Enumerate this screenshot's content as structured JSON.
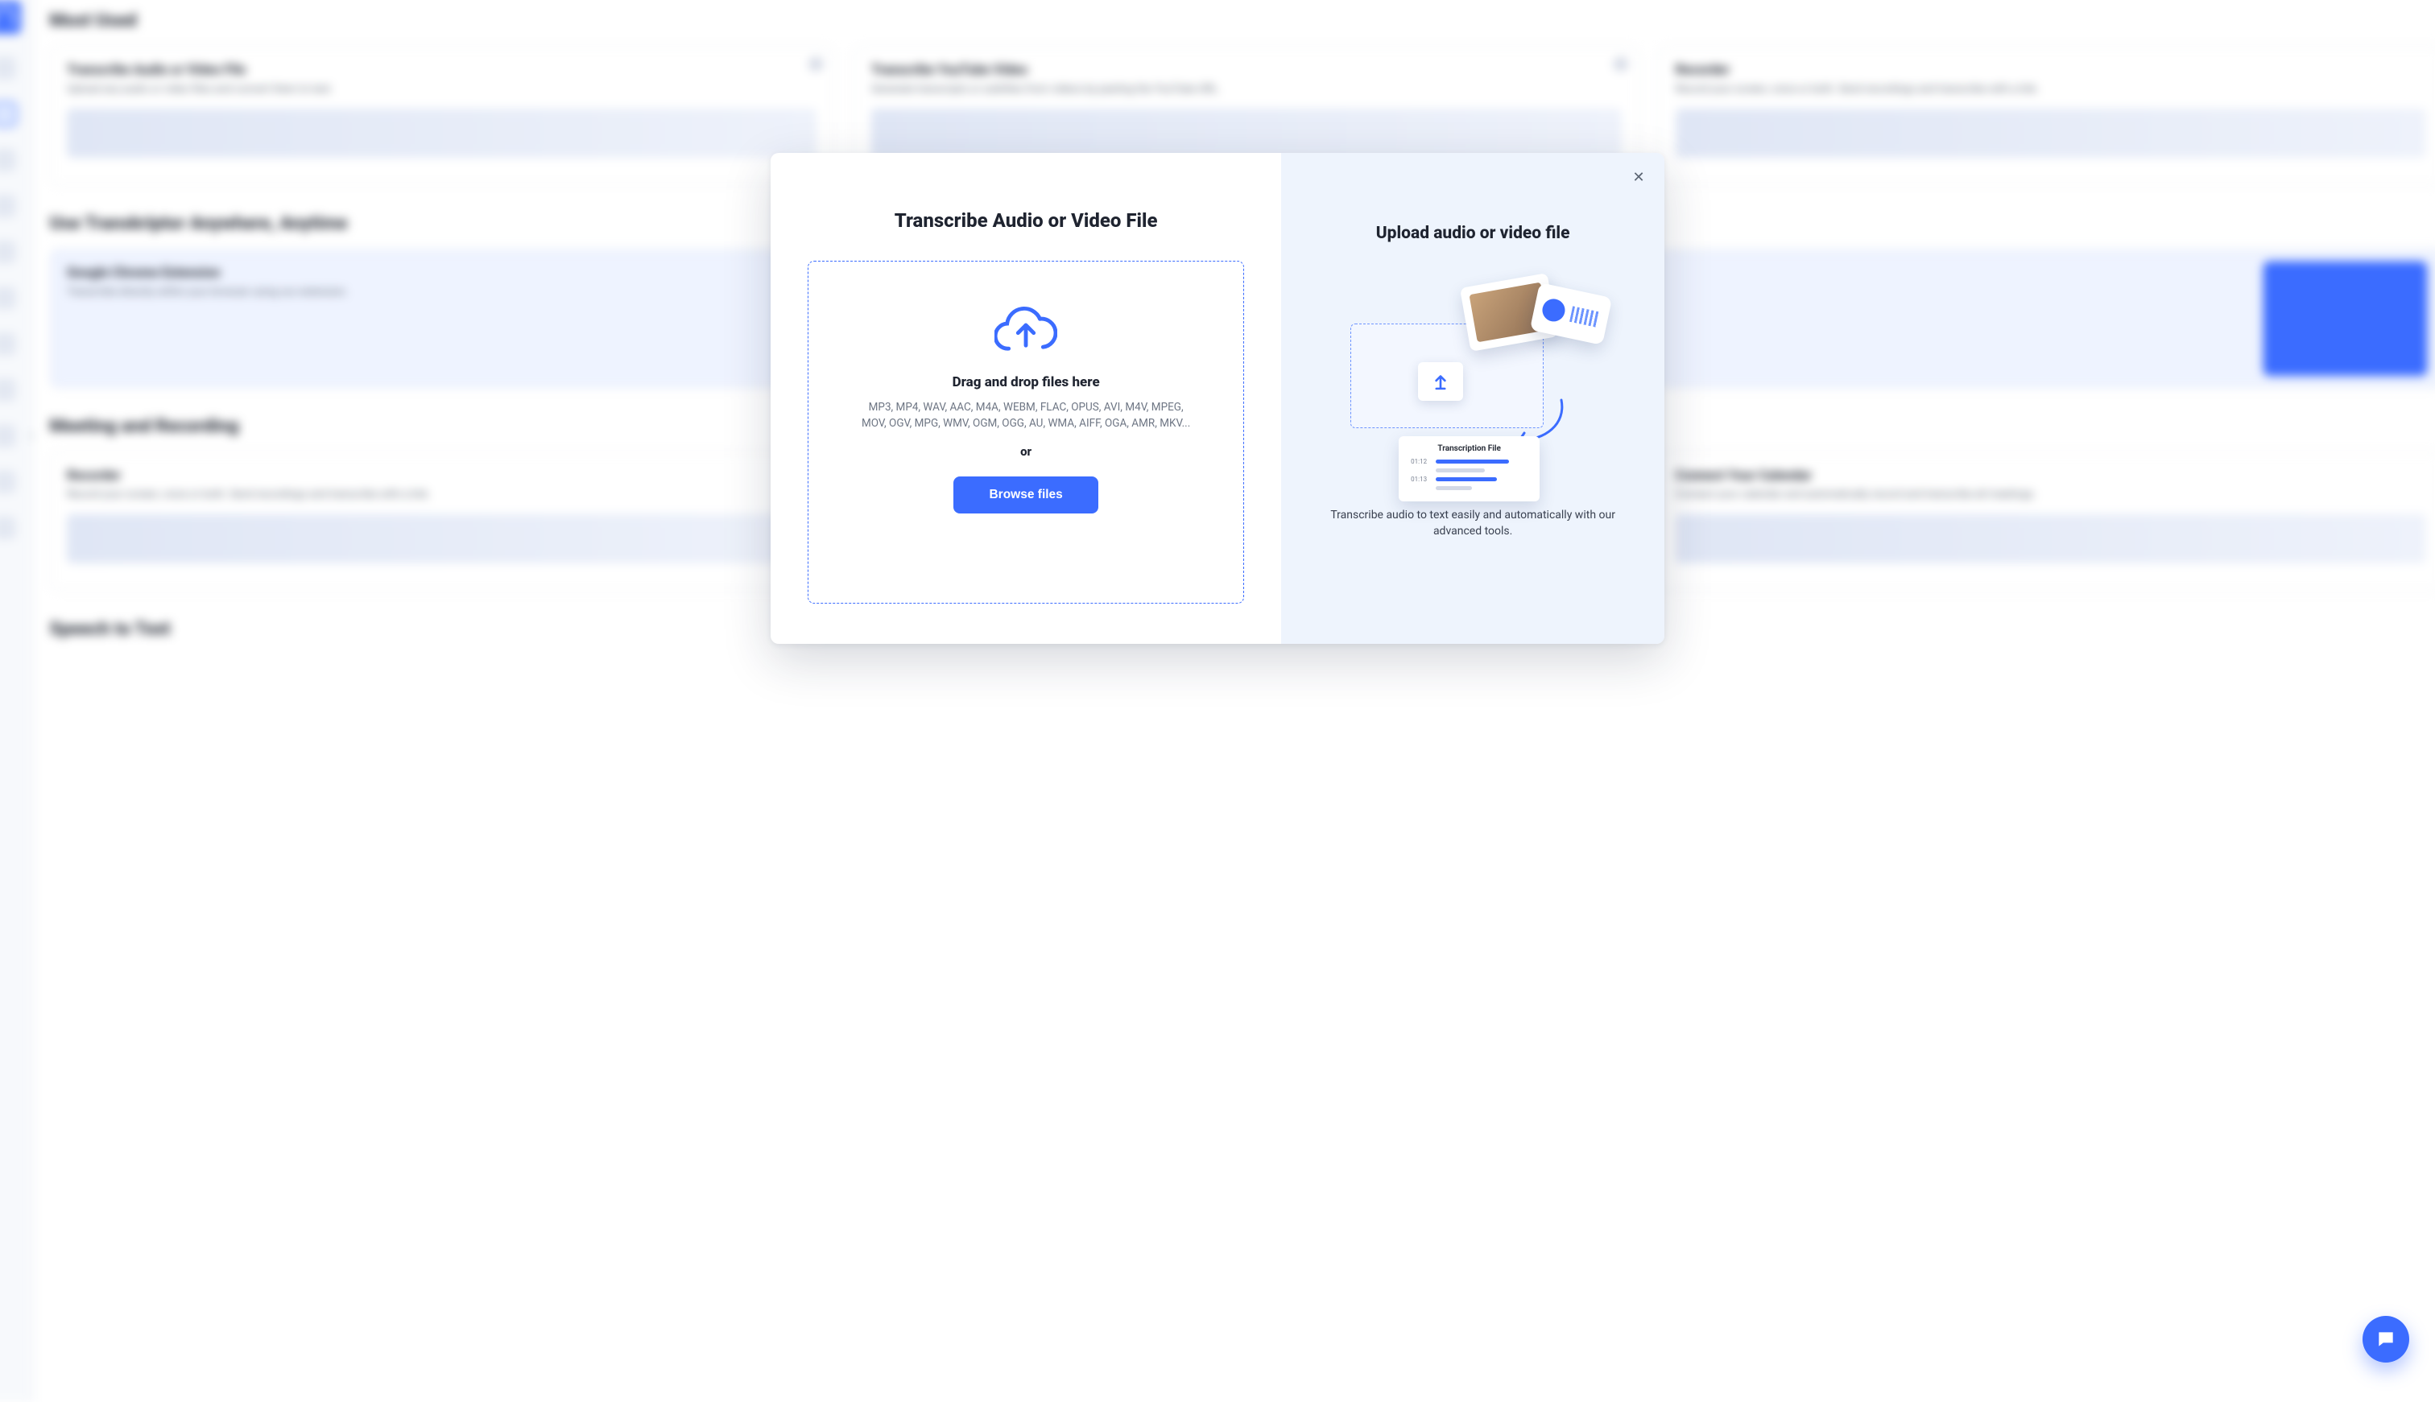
{
  "background": {
    "sections": {
      "most_used": "Most Used",
      "use_anywhere": "Use Transkriptor Anywhere, Anytime",
      "meeting": "Meeting and Recording",
      "speech": "Speech to Text"
    },
    "cards": {
      "transcribe_file": {
        "title": "Transcribe Audio or Video File",
        "desc": "Upload any audio or video files and convert them to text."
      },
      "transcribe_youtube": {
        "title": "Transcribe YouTube Video",
        "desc": "Generate transcripts or subtitles from videos by pasting the YouTube URL."
      },
      "recorder": {
        "title": "Recorder",
        "desc": "Record your screen, voice or both. Send recordings and transcribe with a link."
      },
      "chrome_ext": {
        "title": "Google Chrome Extension",
        "desc": "Transcribe directly within your browser using our extension."
      },
      "recorder2": {
        "title": "Recorder",
        "desc": "Record your screen, voice or both. Send recordings and transcribe with a link."
      },
      "calendar": {
        "title": "Connect Your Calendar",
        "desc": "Connect your calendar and automatically record and transcribe all meetings."
      }
    }
  },
  "modal": {
    "left": {
      "title": "Transcribe Audio or Video File",
      "dropzone_heading": "Drag and drop files here",
      "formats": "MP3, MP4, WAV, AAC, M4A, WEBM, FLAC, OPUS, AVI, M4V, MPEG, MOV, OGV, MPG, WMV, OGM, OGG, AU, WMA, AIFF, OGA, AMR, MKV...",
      "or": "or",
      "browse": "Browse files"
    },
    "right": {
      "title": "Upload audio or video file",
      "blurb": "Transcribe audio to text easily and automatically with our advanced tools.",
      "filecard_title": "Transcription File",
      "filecard_ts1": "01:12",
      "filecard_ts2": "01:13"
    }
  }
}
